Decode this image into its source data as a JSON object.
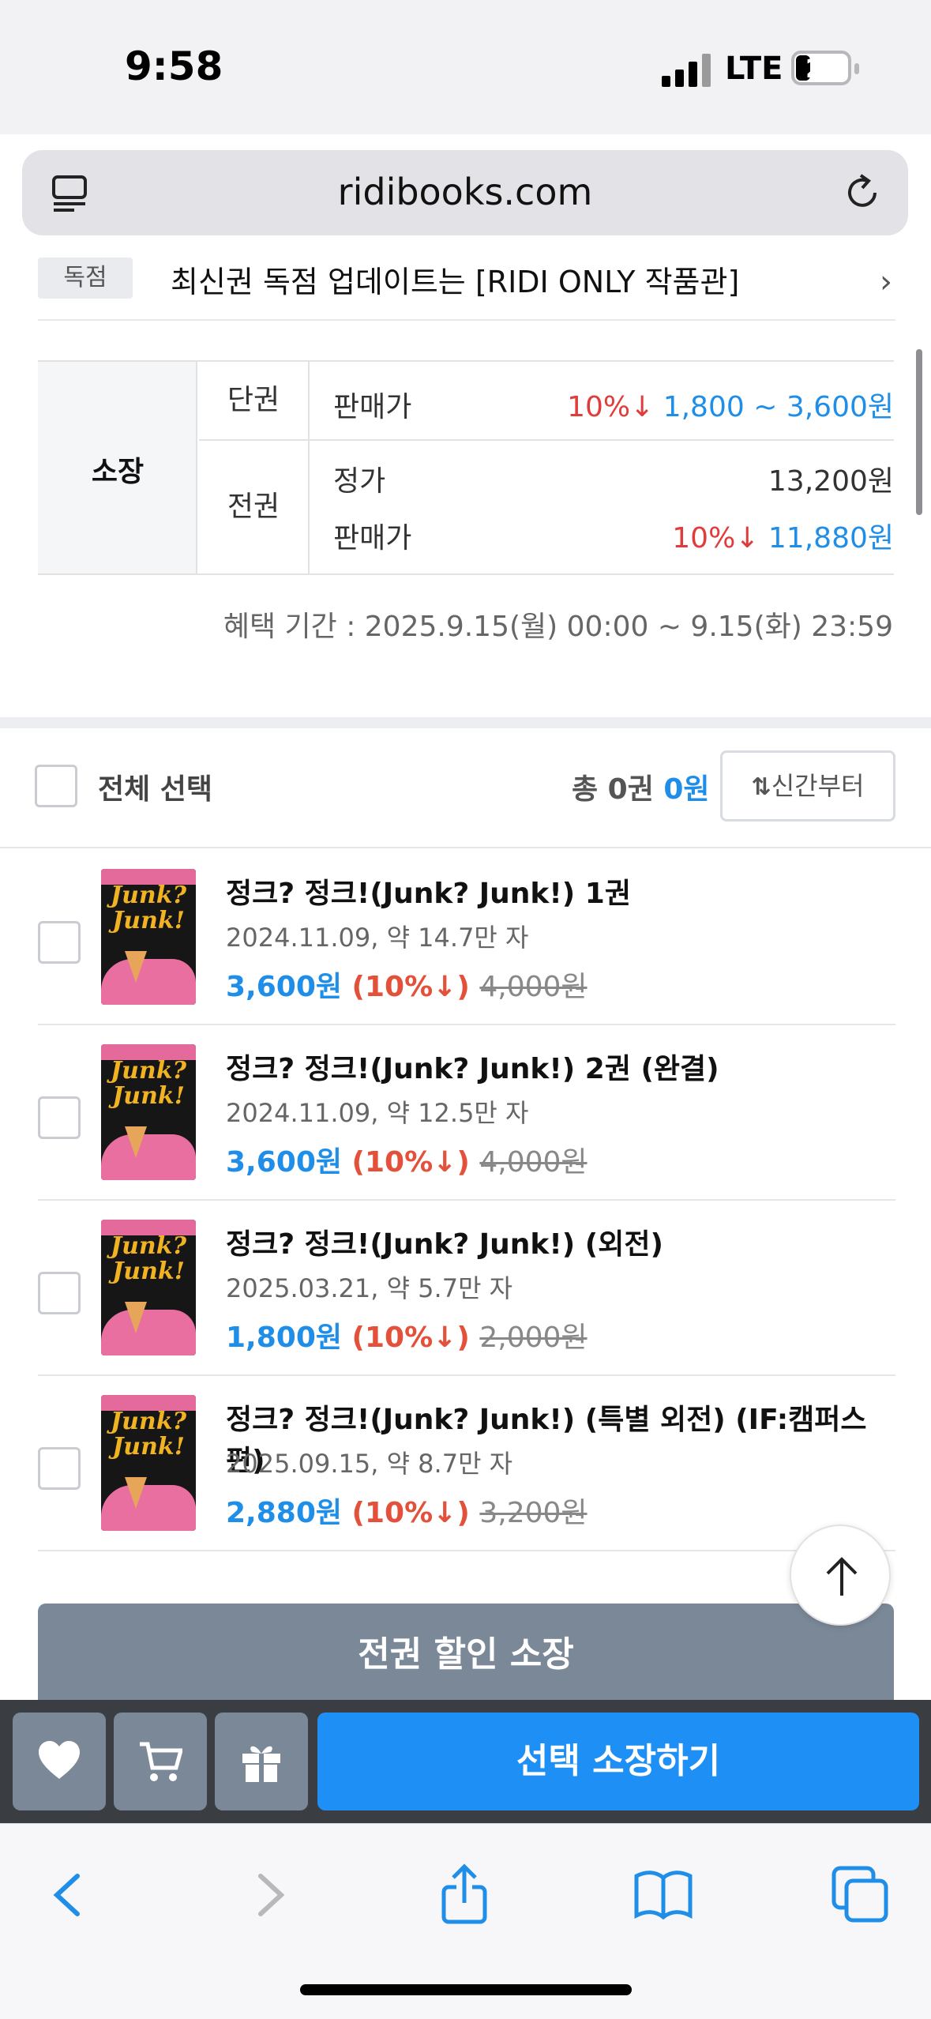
{
  "status_bar": {
    "time": "9:58",
    "network": "LTE",
    "battery": "21"
  },
  "browser": {
    "url": "ridibooks.com"
  },
  "notice": {
    "badge": "독점",
    "text": "최신권 독점 업데이트는 [RIDI ONLY 작품관]"
  },
  "price_table": {
    "own_label": "소장",
    "single": {
      "label": "단권",
      "sale_label": "판매가",
      "discount": "10%↓",
      "price_range": "1,800 ~ 3,600원"
    },
    "full": {
      "label": "전권",
      "list_label": "정가",
      "list_price": "13,200원",
      "sale_label": "판매가",
      "discount": "10%↓",
      "sale_price": "11,880원"
    }
  },
  "benefit_period": "혜택 기간 : 2025.9.15(월) 00:00 ~ 9.15(화) 23:59",
  "selection": {
    "select_all_label": "전체 선택",
    "total_prefix": "총 0권",
    "total_amount": "0원",
    "sort_label": "신간부터"
  },
  "books": [
    {
      "title": "정크? 정크!(Junk? Junk!) 1권",
      "meta": "2024.11.09, 약 14.7만 자",
      "price": "3,600원",
      "discount": "(10%↓)",
      "original": "4,000원",
      "cover_text": "Junk? Junk!"
    },
    {
      "title": "정크? 정크!(Junk? Junk!) 2권 (완결)",
      "meta": "2024.11.09, 약 12.5만 자",
      "price": "3,600원",
      "discount": "(10%↓)",
      "original": "4,000원",
      "cover_text": "Junk? Junk!"
    },
    {
      "title": "정크? 정크!(Junk? Junk!) (외전)",
      "meta": "2025.03.21, 약 5.7만 자",
      "price": "1,800원",
      "discount": "(10%↓)",
      "original": "2,000원",
      "cover_text": "Junk? Junk!"
    },
    {
      "title": "정크? 정크!(Junk? Junk!) (특별 외전) (IF:캠퍼스편)",
      "meta": "2025.09.15, 약 8.7만 자",
      "price": "2,880원",
      "discount": "(10%↓)",
      "original": "3,200원",
      "cover_text": "Junk? Junk!"
    }
  ],
  "buttons": {
    "full_purchase": "전권 할인 소장",
    "select_purchase": "선택 소장하기"
  },
  "icons": [
    "tabs-icon",
    "reload-icon",
    "heart-icon",
    "cart-icon",
    "gift-icon",
    "arrow-up-icon",
    "back-icon",
    "forward-icon",
    "share-icon",
    "bookmarks-icon",
    "tabs-overview-icon"
  ],
  "colors": {
    "accent_blue": "#1e90f5",
    "discount_red": "#e03c3c",
    "button_gray": "#7a8898"
  }
}
